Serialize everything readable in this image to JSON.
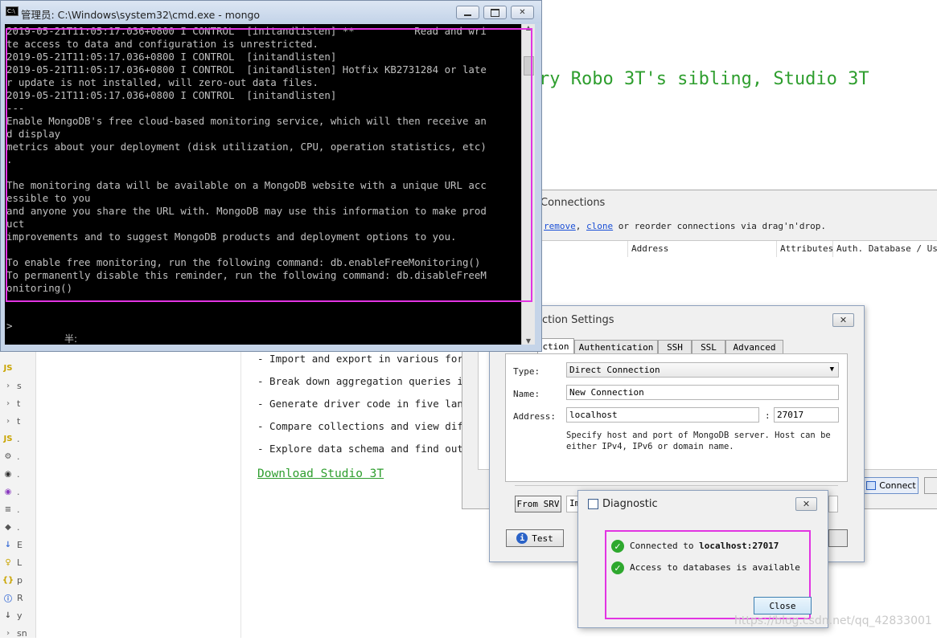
{
  "cmd": {
    "title": "管理员: C:\\Windows\\system32\\cmd.exe - mongo",
    "lines": [
      "2019-05-21T11:05:17.036+0800 I CONTROL  [initandlisten] **          Read and wri",
      "te access to data and configuration is unrestricted.",
      "2019-05-21T11:05:17.036+0800 I CONTROL  [initandlisten]",
      "2019-05-21T11:05:17.036+0800 I CONTROL  [initandlisten] Hotfix KB2731284 or late",
      "r update is not installed, will zero-out data files.",
      "2019-05-21T11:05:17.036+0800 I CONTROL  [initandlisten]",
      "---",
      "Enable MongoDB's free cloud-based monitoring service, which will then receive an",
      "d display",
      "metrics about your deployment (disk utilization, CPU, operation statistics, etc)",
      ".",
      "",
      "The monitoring data will be available on a MongoDB website with a unique URL acc",
      "essible to you",
      "and anyone you share the URL with. MongoDB may use this information to make prod",
      "uct",
      "improvements and to suggest MongoDB products and deployment options to you.",
      "",
      "To enable free monitoring, run the following command: db.enableFreeMonitoring()",
      "To permanently disable this reminder, run the following command: db.disableFreeM",
      "onitoring()"
    ],
    "prompt": ">",
    "ime": "半:"
  },
  "background": {
    "headline": "ry Robo 3T's sibling, Studio 3T",
    "bullets": [
      "- Import and export in various forma",
      "- Break down aggregation queries int",
      "- Generate driver code in five langu",
      "- Compare collections and view diffe",
      "- Explore data schema and find outli"
    ],
    "download": "Download Studio 3T",
    "watermark": "https://blog.csdn.net/qq_42833001",
    "ide_items": [
      {
        "icon": "JS",
        "label": "",
        "color": "#c9a400"
      },
      {
        "icon": "›",
        "label": "s",
        "color": "#888"
      },
      {
        "icon": "›",
        "label": "t",
        "color": "#888"
      },
      {
        "icon": "›",
        "label": "t",
        "color": "#888"
      },
      {
        "icon": "JS",
        "label": ".",
        "color": "#c9a400"
      },
      {
        "icon": "⚙",
        "label": ".",
        "color": "#555"
      },
      {
        "icon": "◉",
        "label": ".",
        "color": "#333"
      },
      {
        "icon": "◉",
        "label": ".",
        "color": "#8a3bbf"
      },
      {
        "icon": "≡",
        "label": ".",
        "color": "#666"
      },
      {
        "icon": "◆",
        "label": ".",
        "color": "#555"
      },
      {
        "icon": "↓",
        "label": "E",
        "color": "#3b6ed6"
      },
      {
        "icon": "♀",
        "label": "L",
        "color": "#c9a400"
      },
      {
        "icon": "{}",
        "label": "p",
        "color": "#c9a400"
      },
      {
        "icon": "ⓘ",
        "label": "R",
        "color": "#3b6ed6"
      },
      {
        "icon": "↓",
        "label": "y",
        "color": "#555"
      },
      {
        "icon": "›",
        "label": "sn",
        "color": "#888"
      }
    ]
  },
  "connections": {
    "title": "Connections",
    "help_remove": "remove",
    "help_sep": ", ",
    "help_clone": "clone",
    "help_rest": " or reorder connections via drag'n'drop.",
    "columns": [
      "Address",
      "Attributes",
      "Auth. Database / User"
    ],
    "connect_label": "Connect"
  },
  "settings": {
    "title": "ction Settings",
    "tabs": [
      "ction",
      "Authentication",
      "SSH",
      "SSL",
      "Advanced"
    ],
    "type_label": "Type:",
    "type_value": "Direct Connection",
    "name_label": "Name:",
    "name_value": "New Connection",
    "address_label": "Address:",
    "host_value": "localhost",
    "port_sep": ":",
    "port_value": "27017",
    "hint": "Specify host and port of MongoDB server. Host can be either IPv4, IPv6 or domain name.",
    "from_srv": "From SRV",
    "import_stub": "Im",
    "test_label": "Test"
  },
  "diagnostic": {
    "title": "Diagnostic",
    "msg1_prefix": "Connected to ",
    "msg1_host": "localhost:27017",
    "msg2": "Access to databases is available",
    "close_label": "Close"
  }
}
